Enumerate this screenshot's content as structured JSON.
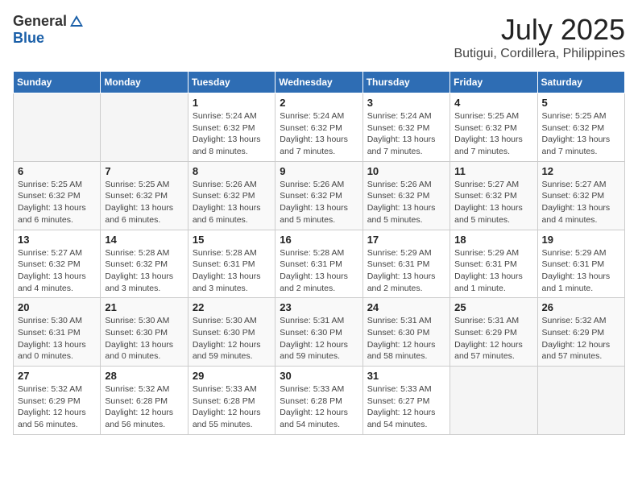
{
  "logo": {
    "general": "General",
    "blue": "Blue"
  },
  "title": {
    "month": "July 2025",
    "location": "Butigui, Cordillera, Philippines"
  },
  "weekdays": [
    "Sunday",
    "Monday",
    "Tuesday",
    "Wednesday",
    "Thursday",
    "Friday",
    "Saturday"
  ],
  "weeks": [
    [
      {
        "day": null
      },
      {
        "day": null
      },
      {
        "day": "1",
        "sunrise": "Sunrise: 5:24 AM",
        "sunset": "Sunset: 6:32 PM",
        "daylight": "Daylight: 13 hours and 8 minutes."
      },
      {
        "day": "2",
        "sunrise": "Sunrise: 5:24 AM",
        "sunset": "Sunset: 6:32 PM",
        "daylight": "Daylight: 13 hours and 7 minutes."
      },
      {
        "day": "3",
        "sunrise": "Sunrise: 5:24 AM",
        "sunset": "Sunset: 6:32 PM",
        "daylight": "Daylight: 13 hours and 7 minutes."
      },
      {
        "day": "4",
        "sunrise": "Sunrise: 5:25 AM",
        "sunset": "Sunset: 6:32 PM",
        "daylight": "Daylight: 13 hours and 7 minutes."
      },
      {
        "day": "5",
        "sunrise": "Sunrise: 5:25 AM",
        "sunset": "Sunset: 6:32 PM",
        "daylight": "Daylight: 13 hours and 7 minutes."
      }
    ],
    [
      {
        "day": "6",
        "sunrise": "Sunrise: 5:25 AM",
        "sunset": "Sunset: 6:32 PM",
        "daylight": "Daylight: 13 hours and 6 minutes."
      },
      {
        "day": "7",
        "sunrise": "Sunrise: 5:25 AM",
        "sunset": "Sunset: 6:32 PM",
        "daylight": "Daylight: 13 hours and 6 minutes."
      },
      {
        "day": "8",
        "sunrise": "Sunrise: 5:26 AM",
        "sunset": "Sunset: 6:32 PM",
        "daylight": "Daylight: 13 hours and 6 minutes."
      },
      {
        "day": "9",
        "sunrise": "Sunrise: 5:26 AM",
        "sunset": "Sunset: 6:32 PM",
        "daylight": "Daylight: 13 hours and 5 minutes."
      },
      {
        "day": "10",
        "sunrise": "Sunrise: 5:26 AM",
        "sunset": "Sunset: 6:32 PM",
        "daylight": "Daylight: 13 hours and 5 minutes."
      },
      {
        "day": "11",
        "sunrise": "Sunrise: 5:27 AM",
        "sunset": "Sunset: 6:32 PM",
        "daylight": "Daylight: 13 hours and 5 minutes."
      },
      {
        "day": "12",
        "sunrise": "Sunrise: 5:27 AM",
        "sunset": "Sunset: 6:32 PM",
        "daylight": "Daylight: 13 hours and 4 minutes."
      }
    ],
    [
      {
        "day": "13",
        "sunrise": "Sunrise: 5:27 AM",
        "sunset": "Sunset: 6:32 PM",
        "daylight": "Daylight: 13 hours and 4 minutes."
      },
      {
        "day": "14",
        "sunrise": "Sunrise: 5:28 AM",
        "sunset": "Sunset: 6:32 PM",
        "daylight": "Daylight: 13 hours and 3 minutes."
      },
      {
        "day": "15",
        "sunrise": "Sunrise: 5:28 AM",
        "sunset": "Sunset: 6:31 PM",
        "daylight": "Daylight: 13 hours and 3 minutes."
      },
      {
        "day": "16",
        "sunrise": "Sunrise: 5:28 AM",
        "sunset": "Sunset: 6:31 PM",
        "daylight": "Daylight: 13 hours and 2 minutes."
      },
      {
        "day": "17",
        "sunrise": "Sunrise: 5:29 AM",
        "sunset": "Sunset: 6:31 PM",
        "daylight": "Daylight: 13 hours and 2 minutes."
      },
      {
        "day": "18",
        "sunrise": "Sunrise: 5:29 AM",
        "sunset": "Sunset: 6:31 PM",
        "daylight": "Daylight: 13 hours and 1 minute."
      },
      {
        "day": "19",
        "sunrise": "Sunrise: 5:29 AM",
        "sunset": "Sunset: 6:31 PM",
        "daylight": "Daylight: 13 hours and 1 minute."
      }
    ],
    [
      {
        "day": "20",
        "sunrise": "Sunrise: 5:30 AM",
        "sunset": "Sunset: 6:31 PM",
        "daylight": "Daylight: 13 hours and 0 minutes."
      },
      {
        "day": "21",
        "sunrise": "Sunrise: 5:30 AM",
        "sunset": "Sunset: 6:30 PM",
        "daylight": "Daylight: 13 hours and 0 minutes."
      },
      {
        "day": "22",
        "sunrise": "Sunrise: 5:30 AM",
        "sunset": "Sunset: 6:30 PM",
        "daylight": "Daylight: 12 hours and 59 minutes."
      },
      {
        "day": "23",
        "sunrise": "Sunrise: 5:31 AM",
        "sunset": "Sunset: 6:30 PM",
        "daylight": "Daylight: 12 hours and 59 minutes."
      },
      {
        "day": "24",
        "sunrise": "Sunrise: 5:31 AM",
        "sunset": "Sunset: 6:30 PM",
        "daylight": "Daylight: 12 hours and 58 minutes."
      },
      {
        "day": "25",
        "sunrise": "Sunrise: 5:31 AM",
        "sunset": "Sunset: 6:29 PM",
        "daylight": "Daylight: 12 hours and 57 minutes."
      },
      {
        "day": "26",
        "sunrise": "Sunrise: 5:32 AM",
        "sunset": "Sunset: 6:29 PM",
        "daylight": "Daylight: 12 hours and 57 minutes."
      }
    ],
    [
      {
        "day": "27",
        "sunrise": "Sunrise: 5:32 AM",
        "sunset": "Sunset: 6:29 PM",
        "daylight": "Daylight: 12 hours and 56 minutes."
      },
      {
        "day": "28",
        "sunrise": "Sunrise: 5:32 AM",
        "sunset": "Sunset: 6:28 PM",
        "daylight": "Daylight: 12 hours and 56 minutes."
      },
      {
        "day": "29",
        "sunrise": "Sunrise: 5:33 AM",
        "sunset": "Sunset: 6:28 PM",
        "daylight": "Daylight: 12 hours and 55 minutes."
      },
      {
        "day": "30",
        "sunrise": "Sunrise: 5:33 AM",
        "sunset": "Sunset: 6:28 PM",
        "daylight": "Daylight: 12 hours and 54 minutes."
      },
      {
        "day": "31",
        "sunrise": "Sunrise: 5:33 AM",
        "sunset": "Sunset: 6:27 PM",
        "daylight": "Daylight: 12 hours and 54 minutes."
      },
      {
        "day": null
      },
      {
        "day": null
      }
    ]
  ]
}
